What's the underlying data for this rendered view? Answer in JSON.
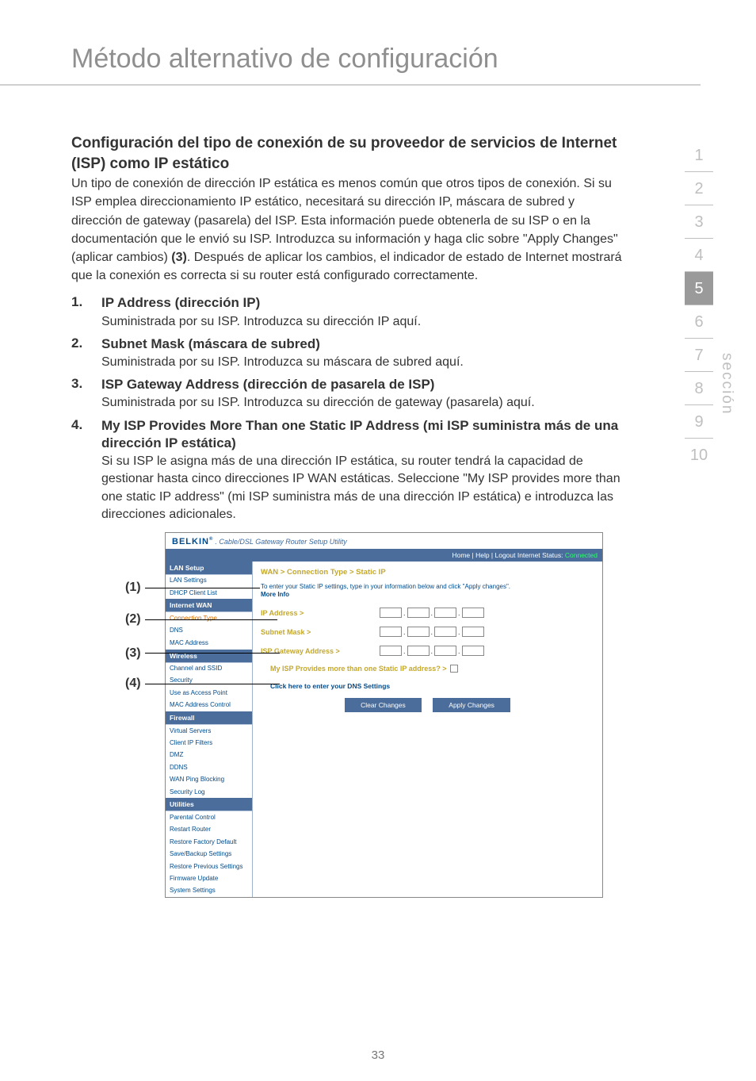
{
  "page": {
    "title": "Método alternativo de configuración",
    "number": "33"
  },
  "heading": "Configuración del tipo de conexión de su proveedor de servicios de Internet (ISP) como IP estático",
  "intro": "Un tipo de conexión de dirección IP estática es menos común que otros tipos de conexión. Si su ISP emplea direccionamiento IP estático, necesitará su dirección IP, máscara de subred y dirección de gateway (pasarela) del ISP. Esta información puede obtenerla de su ISP o en la documentación que le envió su ISP. Introduzca su información y haga clic sobre \"Apply Changes\" (aplicar cambios) ",
  "intro_bold": "(3)",
  "intro_tail": ". Después de aplicar los cambios, el indicador de estado de Internet mostrará que la conexión es correcta si su router está configurado correctamente.",
  "items": [
    {
      "num": "1.",
      "title": "IP Address (dirección IP)",
      "text": "Suministrada por su ISP. Introduzca su dirección IP aquí."
    },
    {
      "num": "2.",
      "title": "Subnet Mask (máscara de subred)",
      "text": "Suministrada por su ISP. Introduzca su máscara de subred aquí."
    },
    {
      "num": "3.",
      "title": "ISP Gateway Address (dirección de pasarela de ISP)",
      "text": "Suministrada por su ISP. Introduzca su dirección de gateway (pasarela) aquí."
    },
    {
      "num": "4.",
      "title": "My ISP Provides More Than one Static IP Address (mi ISP suministra más de una dirección IP estática)",
      "text": "Si su ISP le asigna más de una dirección IP estática, su router tendrá la capacidad de gestionar hasta cinco direcciones IP WAN estáticas. Seleccione \"My ISP provides more than one static IP address\" (mi ISP suministra más de una dirección IP estática) e introduzca las direcciones adicionales."
    }
  ],
  "nav": {
    "items": [
      "1",
      "2",
      "3",
      "4",
      "5",
      "6",
      "7",
      "8",
      "9",
      "10"
    ],
    "active_index": 4,
    "label": "sección"
  },
  "callouts": [
    "(1)",
    "(2)",
    "(3)",
    "(4)"
  ],
  "router": {
    "brand": "BELKIN",
    "brand_sub": ". Cable/DSL Gateway Router Setup Utility",
    "topnav": "Home | Help | Logout   Internet Status:",
    "status_value": "Connected",
    "breadcrumb": "WAN > Connection Type > Static IP",
    "intro": "To enter your Static IP settings, type in your information below and click \"Apply changes\".",
    "more": "More Info",
    "f_ip": "IP Address >",
    "f_subnet": "Subnet Mask >",
    "f_gw": "ISP Gateway Address >",
    "f_multi": "My ISP Provides more than one Static IP address? >",
    "dns_link": "Click here to enter your DNS Settings",
    "btn_clear": "Clear Changes",
    "btn_apply": "Apply Changes",
    "side": {
      "g1": "LAN Setup",
      "g1i": [
        "LAN Settings",
        "DHCP Client List"
      ],
      "g2": "Internet WAN",
      "g2i": [
        "Connection Type",
        "DNS",
        "MAC Address"
      ],
      "g3": "Wireless",
      "g3i": [
        "Channel and SSID",
        "Security",
        "Use as Access Point",
        "MAC Address Control"
      ],
      "g4": "Firewall",
      "g4i": [
        "Virtual Servers",
        "Client IP Filters",
        "DMZ",
        "DDNS",
        "WAN Ping Blocking",
        "Security Log"
      ],
      "g5": "Utilities",
      "g5i": [
        "Parental Control",
        "Restart Router",
        "Restore Factory Default",
        "Save/Backup Settings",
        "Restore Previous Settings",
        "Firmware Update",
        "System Settings"
      ]
    }
  }
}
